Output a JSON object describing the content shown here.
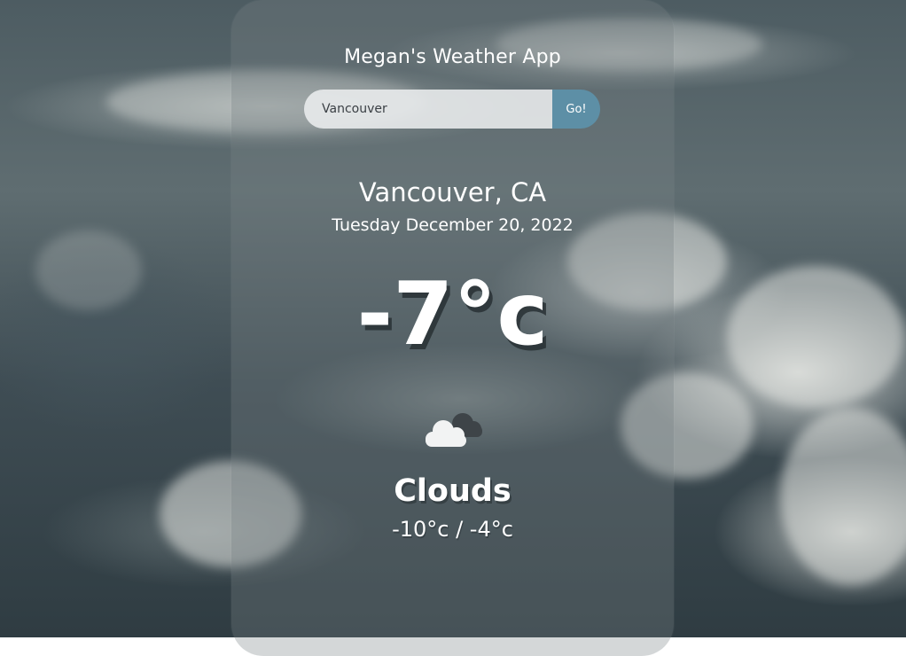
{
  "app": {
    "title": "Megan's Weather App"
  },
  "search": {
    "value": "Vancouver",
    "placeholder": "Vancouver",
    "button_label": "Go!"
  },
  "weather": {
    "location": "Vancouver, CA",
    "date": "Tuesday December 20, 2022",
    "temperature": "-7°c",
    "condition": "Clouds",
    "condition_icon": "clouds-icon",
    "range": "-10°c / -4°c"
  },
  "colors": {
    "button": "#5d8fa6",
    "text": "#ffffff"
  }
}
